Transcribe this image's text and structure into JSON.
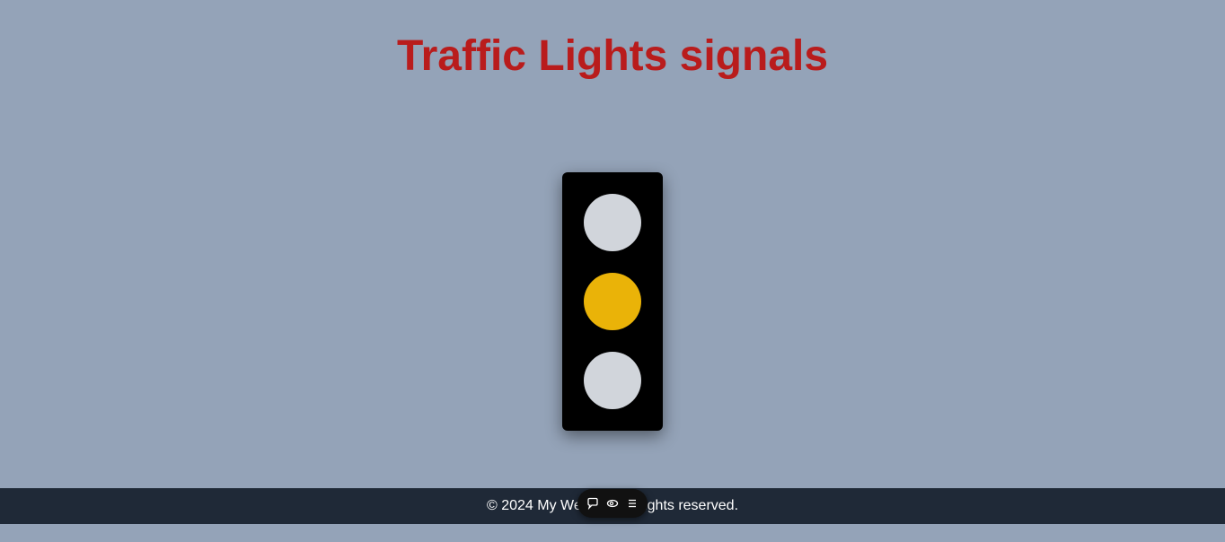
{
  "page": {
    "title": "Traffic Lights signals",
    "background_color": "#94a3b8",
    "title_color": "#b91c1c"
  },
  "traffic_light": {
    "housing_color": "#000000",
    "lamps": [
      {
        "position": "top",
        "state": "off",
        "color": "#d1d5db"
      },
      {
        "position": "middle",
        "state": "on",
        "color": "#eab308"
      },
      {
        "position": "bottom",
        "state": "off",
        "color": "#d1d5db"
      }
    ]
  },
  "footer": {
    "text": "© 2024 My Website. All rights reserved.",
    "background_color": "#1f2937"
  },
  "overlay_toolbar": {
    "icons": [
      "comment-icon",
      "eye-icon",
      "menu-icon"
    ]
  }
}
